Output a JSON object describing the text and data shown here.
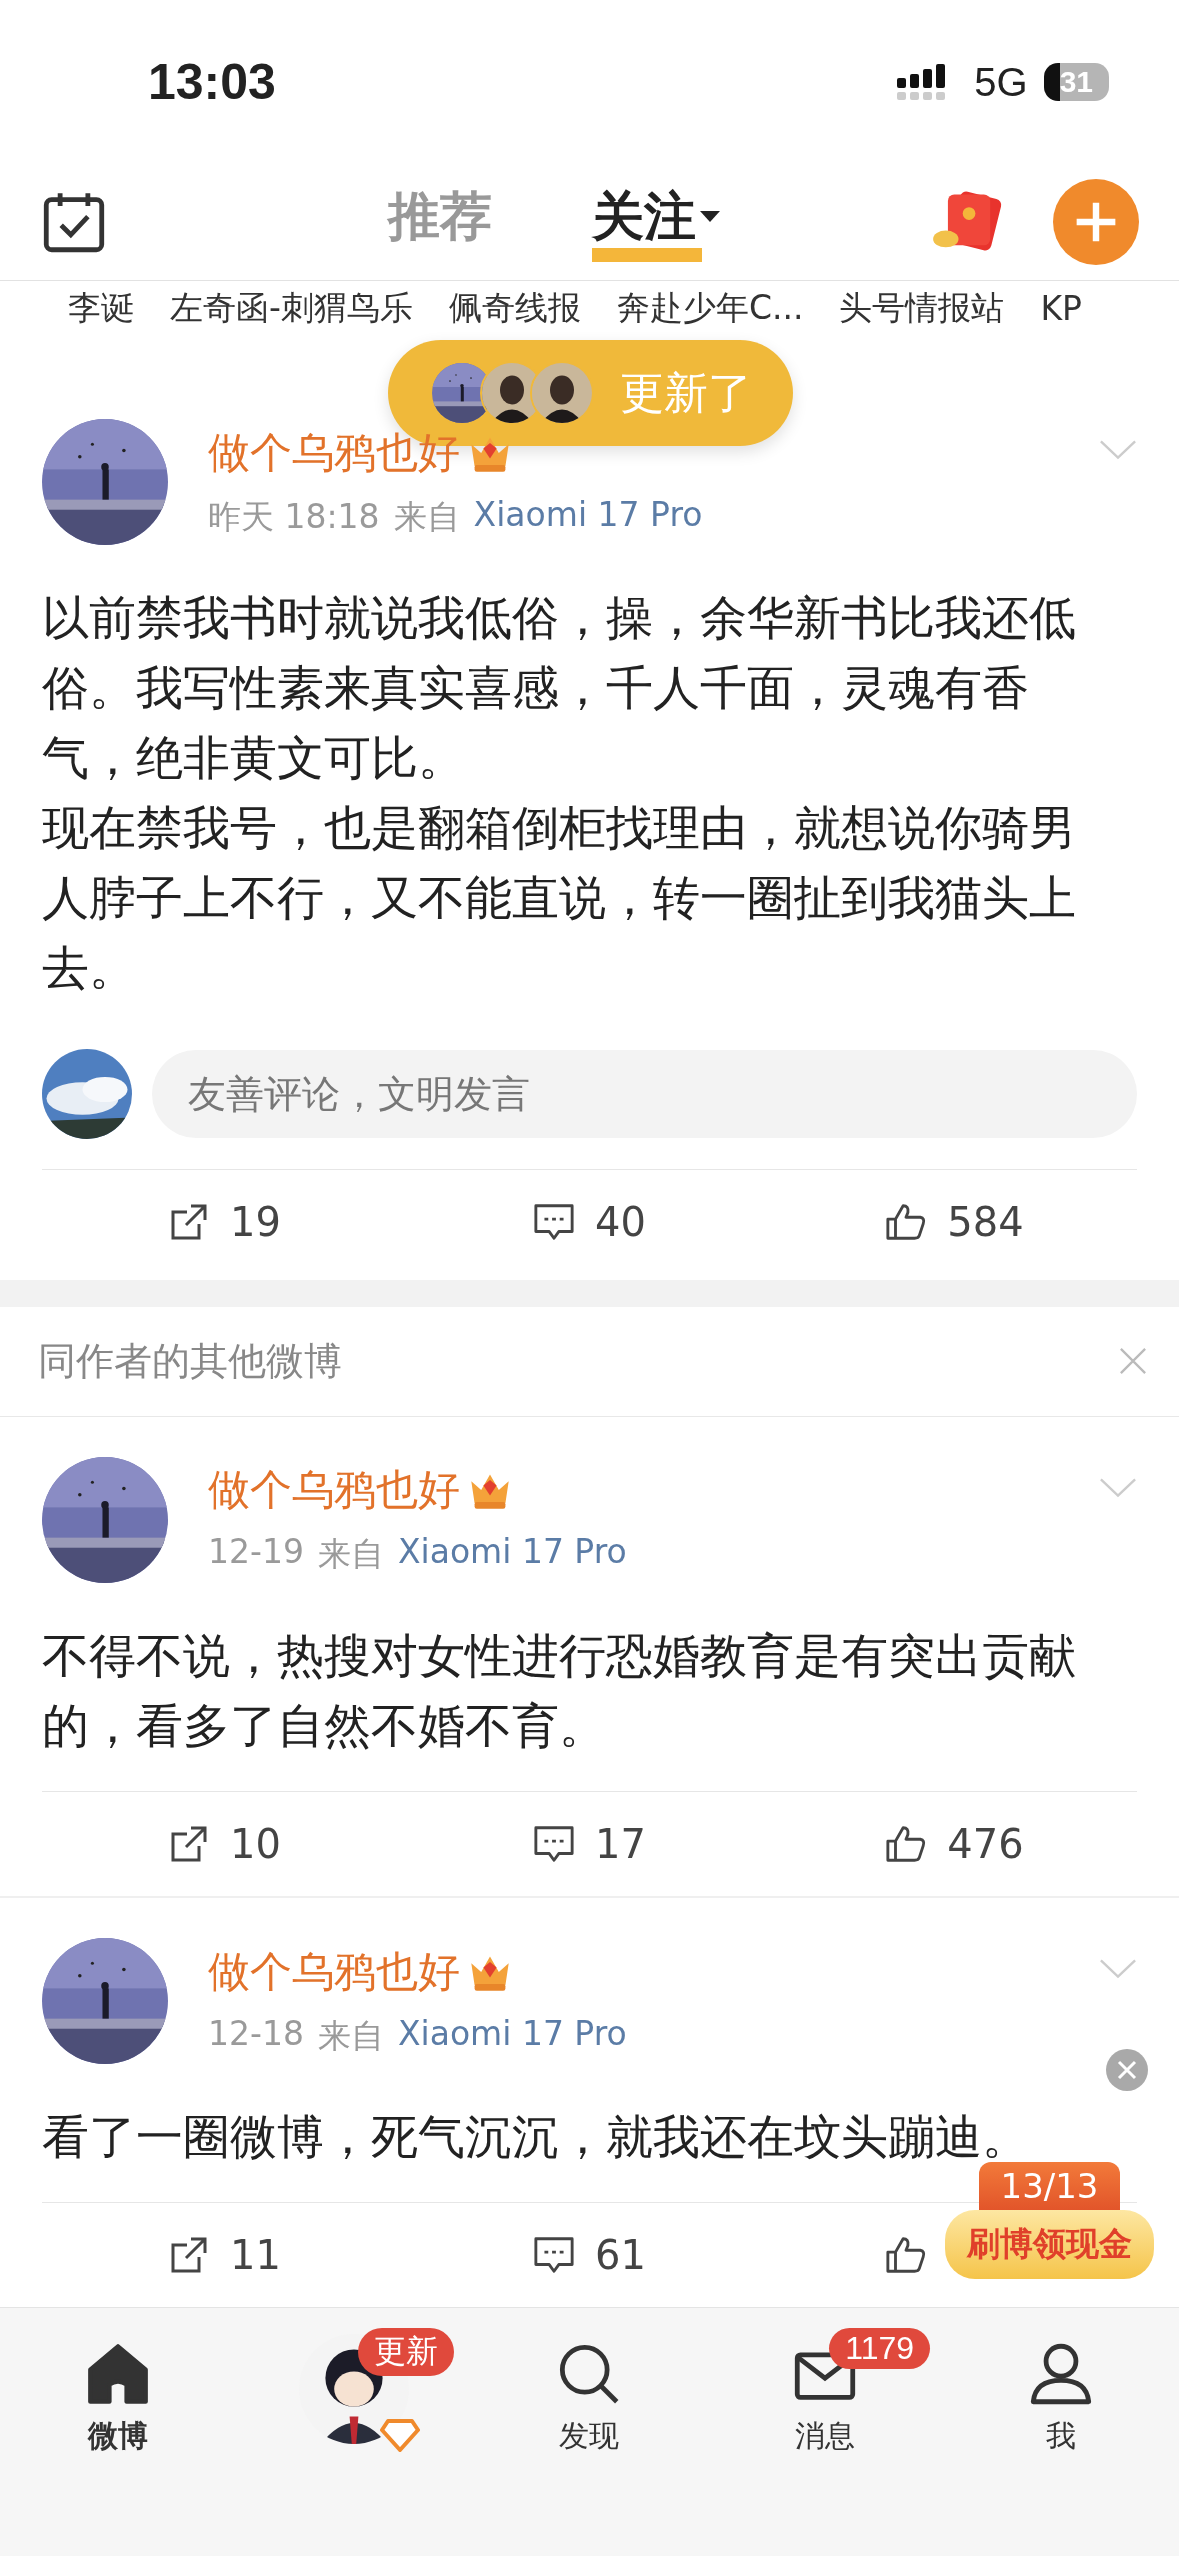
{
  "status_bar": {
    "time": "13:03",
    "network": "5G",
    "battery": "31"
  },
  "top_nav": {
    "tabs": [
      {
        "label": "推荐",
        "selected": false
      },
      {
        "label": "关注",
        "selected": true
      }
    ]
  },
  "following_strip": [
    "李诞",
    "左奇函-刺猬鸟乐",
    "佩奇线报",
    "奔赴少年C...",
    "头号情报站",
    "KP"
  ],
  "update_pill": {
    "label": "更新了"
  },
  "posts": [
    {
      "author": "做个乌鸦也好",
      "time": "昨天 18:18",
      "source_prefix": "来自",
      "source": "Xiaomi 17 Pro",
      "paragraphs": [
        "以前禁我书时就说我低俗，操，余华新书比我还低俗。我写性素来真实喜感，千人千面，灵魂有香气，绝非黄文可比。",
        "现在禁我号，也是翻箱倒柜找理由，就想说你骑男人脖子上不行，又不能直说，转一圈扯到我猫头上去。"
      ],
      "comment_placeholder": "友善评论，文明发言",
      "reposts": "19",
      "comments": "40",
      "likes": "584"
    }
  ],
  "related_section": {
    "title": "同作者的其他微博",
    "posts": [
      {
        "author": "做个乌鸦也好",
        "time": "12-19",
        "source_prefix": "来自",
        "source": "Xiaomi 17 Pro",
        "paragraphs": [
          "不得不说，热搜对女性进行恐婚教育是有突出贡献的，看多了自然不婚不育。"
        ],
        "reposts": "10",
        "comments": "17",
        "likes": "476"
      },
      {
        "author": "做个乌鸦也好",
        "time": "12-18",
        "source_prefix": "来自",
        "source": "Xiaomi 17 Pro",
        "paragraphs": [
          "看了一圈微博，死气沉沉，就我还在坟头蹦迪。"
        ],
        "reposts": "11",
        "comments": "61"
      }
    ]
  },
  "promo": {
    "counter": "13/13",
    "label": "刷博领现金"
  },
  "bottom_nav": [
    {
      "kind": "home",
      "label": "微博",
      "selected": true
    },
    {
      "kind": "avatar",
      "badge": "更新"
    },
    {
      "kind": "discover",
      "label": "发现",
      "selected": false
    },
    {
      "kind": "messages",
      "label": "消息",
      "badge": "1179",
      "selected": false
    },
    {
      "kind": "me",
      "label": "我",
      "selected": false
    }
  ]
}
